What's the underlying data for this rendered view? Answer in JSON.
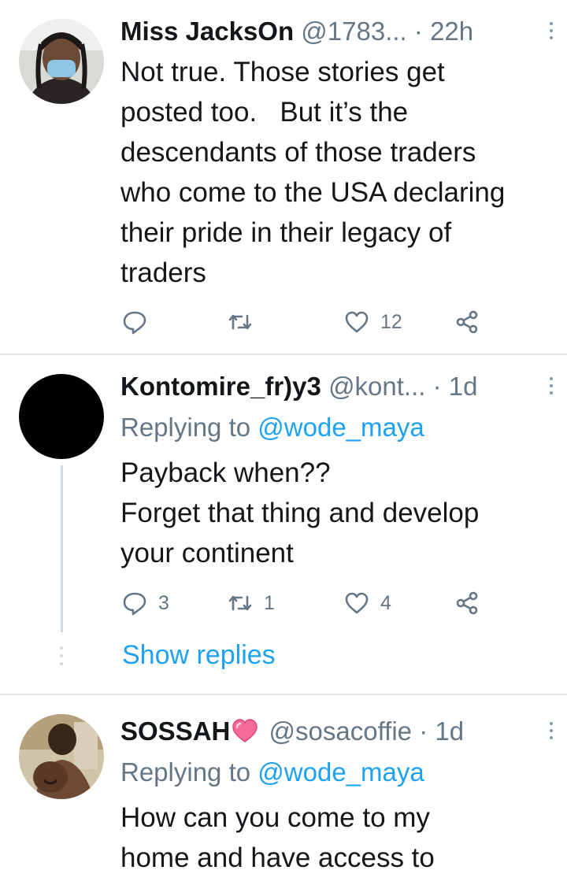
{
  "tweets": [
    {
      "name": "Miss JacksOn",
      "handle": "@1783...",
      "time": "22h",
      "lines": [
        "Not true. Those stories get",
        "posted too.   But it’s the",
        "descendants of those traders",
        "who come to the USA declaring",
        "their pride in their legacy of",
        "traders"
      ],
      "reply_count": "",
      "retweet_count": "",
      "like_count": "12"
    },
    {
      "name": "Kontomire_fr)y3",
      "handle": "@kont...",
      "time": "1d",
      "replying_prefix": "Replying to",
      "replying_to": "@wode_maya",
      "lines": [
        "Payback when??",
        "Forget that thing and develop",
        "your continent"
      ],
      "reply_count": "3",
      "retweet_count": "1",
      "like_count": "4",
      "show_replies": "Show replies"
    },
    {
      "name": "SOSSAH",
      "handle": "@sosacoffie",
      "time": "1d",
      "replying_prefix": "Replying to",
      "replying_to": "@wode_maya",
      "lines": [
        "How can you come to my",
        "home and have access to"
      ]
    }
  ],
  "separator": "·",
  "colors": {
    "text": "#14171a",
    "secondary": "#657786",
    "accent": "#1da1f2",
    "divider": "#e1e8ed",
    "icon": "#657786"
  },
  "icons": [
    "reply-icon",
    "retweet-icon",
    "like-icon",
    "share-icon",
    "more-icon",
    "heart-emoji-icon"
  ]
}
